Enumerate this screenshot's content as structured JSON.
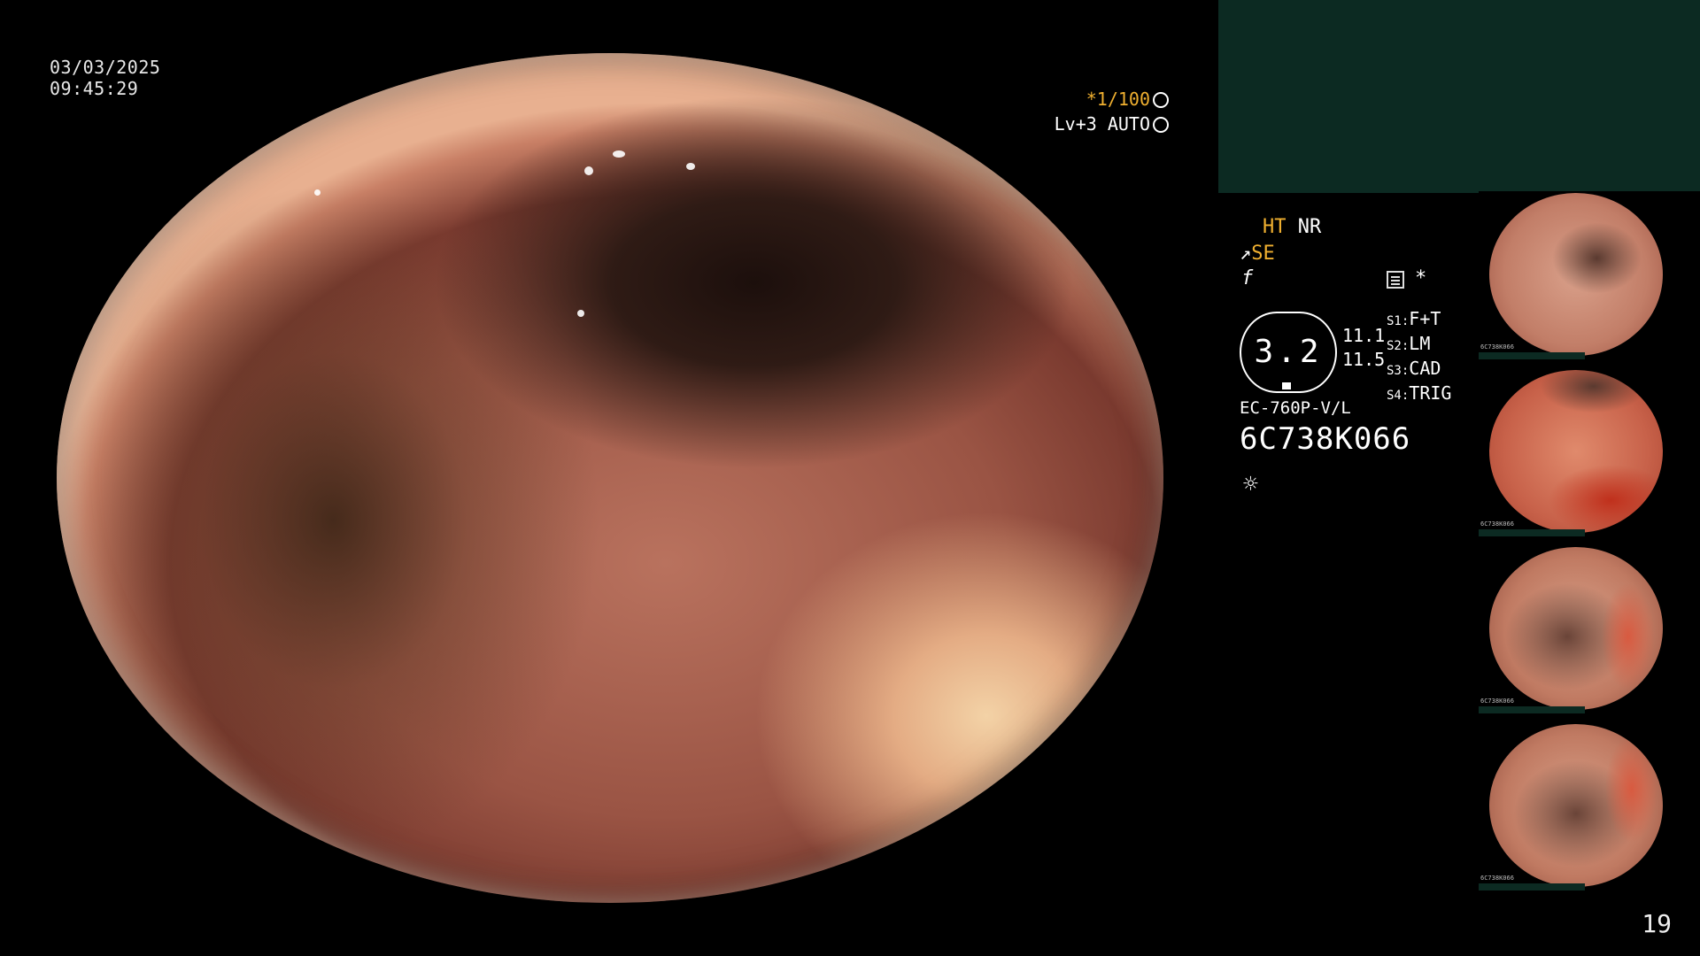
{
  "overlay": {
    "date": "03/03/2025",
    "time": "09:45:29",
    "shutter": "*1/100",
    "level": "Lv+3 AUTO"
  },
  "status": {
    "ht": "HT",
    "nr": "NR",
    "se": "SE",
    "star": "*",
    "hex_value": "3.2",
    "value_1": "11.1",
    "value_2": "11.5",
    "switches": [
      {
        "key": "S1:",
        "value": "F+T"
      },
      {
        "key": "S2:",
        "value": "LM"
      },
      {
        "key": "S3:",
        "value": "CAD"
      },
      {
        "key": "S4:",
        "value": "TRIG"
      }
    ],
    "scope_model": "EC-760P-V/L",
    "serial": "6C738K066"
  },
  "icons": {
    "sun": "☼",
    "se_symbol": "↗",
    "f_symbol": "f"
  },
  "thumbnails": [
    {
      "label": "6C738K066"
    },
    {
      "label": "6C738K066"
    },
    {
      "label": "6C738K066"
    },
    {
      "label": "6C738K066"
    }
  ],
  "page_number": "19",
  "colors": {
    "accent_orange": "#f0b030",
    "banner_green": "#0c2a22",
    "background": "#000000"
  }
}
